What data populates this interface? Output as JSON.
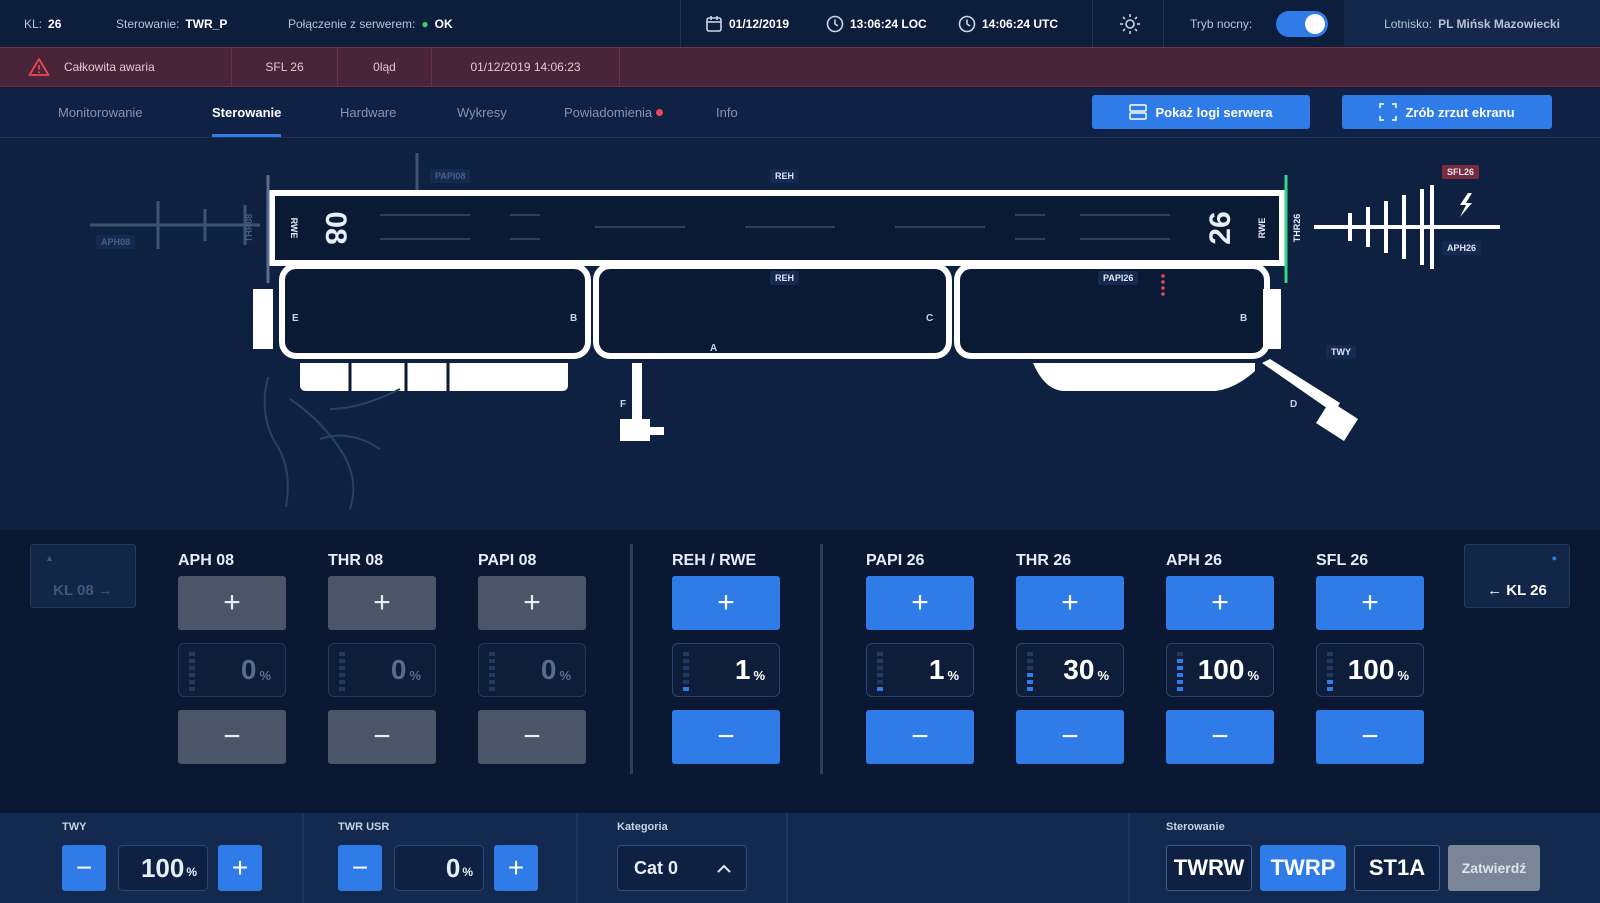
{
  "topbar": {
    "kl_label": "KL:",
    "kl_value": "26",
    "control_label": "Sterowanie:",
    "control_value": "TWR_P",
    "connection_label": "Połączenie z serwerem:",
    "connection_value": "OK",
    "date": "01/12/2019",
    "loc_time": "13:06:24 LOC",
    "utc_time": "14:06:24 UTC",
    "night_mode_label": "Tryb nocny:",
    "airport_label": "Lotnisko:",
    "airport_value": "PL Mińsk Mazowiecki"
  },
  "alarm": {
    "text": "Całkowita awaria",
    "device": "SFL 26",
    "state": "0ląd",
    "timestamp": "01/12/2019 14:06:23"
  },
  "tabs": [
    "Monitorowanie",
    "Sterowanie",
    "Hardware",
    "Wykresy",
    "Powiadomienia",
    "Info"
  ],
  "actions": {
    "show_logs": "Pokaż logi serwera",
    "screenshot": "Zrób zrzut ekranu"
  },
  "map": {
    "runway_left_number": "08",
    "runway_right_number": "26",
    "labels": {
      "rwe": "RWE",
      "reh_top": "REH",
      "reh_mid": "REH",
      "papi26": "PAPI26",
      "thr26": "THR26",
      "sfl26": "SFL26",
      "aph26": "APH26",
      "twy": "TWY",
      "rwe_right": "RWE",
      "aph08": "APH08",
      "thr08": "THR08",
      "papi08": "PAPI08",
      "e": "E",
      "b1": "B",
      "a": "A",
      "c": "C",
      "b2": "B",
      "f": "F",
      "d": "D"
    }
  },
  "controls": {
    "kl_left": "KL 08 →",
    "kl_right": "← KL 26",
    "items": [
      {
        "name": "APH 08",
        "value": "0",
        "unit": "%",
        "enabled": false,
        "level": 0
      },
      {
        "name": "THR 08",
        "value": "0",
        "unit": "%",
        "enabled": false,
        "level": 0
      },
      {
        "name": "PAPI 08",
        "value": "0",
        "unit": "%",
        "enabled": false,
        "level": 0
      },
      {
        "name": "REH / RWE",
        "value": "1",
        "unit": "%",
        "enabled": true,
        "level": 1
      },
      {
        "name": "PAPI 26",
        "value": "1",
        "unit": "%",
        "enabled": true,
        "level": 1
      },
      {
        "name": "THR 26",
        "value": "30",
        "unit": "%",
        "enabled": true,
        "level": 3
      },
      {
        "name": "APH 26",
        "value": "100",
        "unit": "%",
        "enabled": true,
        "level": 5
      },
      {
        "name": "SFL 26",
        "value": "100",
        "unit": "%",
        "enabled": true,
        "level": 2
      }
    ]
  },
  "bottom": {
    "twy_label": "TWY",
    "twy_value": "100",
    "twy_unit": "%",
    "twr_usr_label": "TWR USR",
    "twr_usr_value": "0",
    "twr_usr_unit": "%",
    "category_label": "Kategoria",
    "category_value": "Cat 0",
    "control_label": "Sterowanie",
    "modes": [
      "TWRW",
      "TWRP",
      "ST1A"
    ],
    "active_mode": "TWRP",
    "apply_label": "Zatwierdź"
  },
  "colors": {
    "accent": "#2f7be7",
    "alarm": "#4a2438",
    "background": "#0c1a33"
  }
}
